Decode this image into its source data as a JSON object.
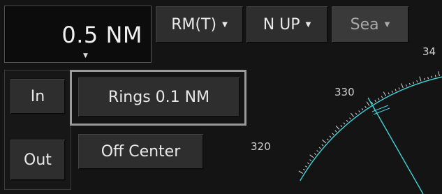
{
  "range": {
    "value": "0.5 NM"
  },
  "toolbar": {
    "motion_label": "RM(T)",
    "orientation_label": "N UP",
    "mode_label": "Sea"
  },
  "zoom": {
    "in_label": "In",
    "out_label": "Out"
  },
  "rings": {
    "label": "Rings 0.1 NM"
  },
  "off_center": {
    "label": "Off Center"
  },
  "bearings": {
    "b340": "34",
    "b330": "330",
    "b320": "320"
  },
  "colors": {
    "sweep": "#3fd2d8",
    "background": "#141414"
  }
}
